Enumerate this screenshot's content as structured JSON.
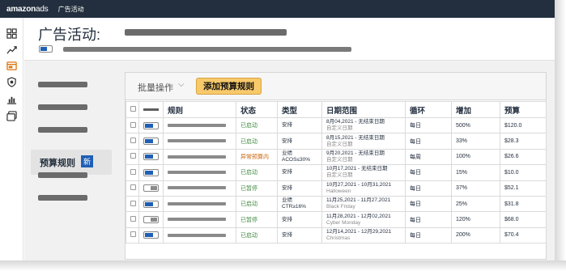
{
  "topbar": {
    "logo_main": "amazon",
    "logo_ads": "ads",
    "nav_title": "广告活动"
  },
  "colors": {
    "topbar": "#232f3e",
    "accent_blue": "#1f5fb4",
    "button_yellow": "#f7c96a",
    "status_green": "#3c8a3c",
    "status_orange": "#c8640a"
  },
  "rail": {
    "icons": [
      "dashboard-icon",
      "trend-icon",
      "campaign-icon",
      "shield-icon",
      "bar-chart-icon",
      "media-icon"
    ]
  },
  "header": {
    "title": "广告活动:"
  },
  "leftnav": {
    "active_label": "预算规则",
    "new_badge": "新"
  },
  "toolbar": {
    "bulk_label": "批量操作",
    "bulk_caret": "⌵",
    "add_button": "添加预算规则"
  },
  "table": {
    "headers": [
      "",
      "",
      "规则",
      "状态",
      "类型",
      "日期范围",
      "循环",
      "增加",
      "预算"
    ],
    "rows": [
      {
        "toggle": "on",
        "status": "已启动",
        "status_color": "green",
        "type1": "安排",
        "type2": "",
        "date1": "8月04,2021 - 无结束日期",
        "date2": "自定义日期",
        "cycle": "每日",
        "increase": "500%",
        "budget": "$120.0"
      },
      {
        "toggle": "on",
        "status": "已启动",
        "status_color": "green",
        "type1": "安排",
        "type2": "",
        "date1": "8月15,2021 - 无结束日期",
        "date2": "自定义日期",
        "cycle": "每日",
        "increase": "33%",
        "budget": "$28.3"
      },
      {
        "toggle": "on",
        "status": "异常预算内",
        "status_color": "orange",
        "type1": "业绩",
        "type2": "ACOS≤30%",
        "date1": "9月20,2021 - 无结束日期",
        "date2": "自定义日期",
        "cycle": "每周",
        "increase": "100%",
        "budget": "$26.6"
      },
      {
        "toggle": "on",
        "status": "已启动",
        "status_color": "green",
        "type1": "安排",
        "type2": "",
        "date1": "10月17,2021 - 无结束日期",
        "date2": "自定义日期",
        "cycle": "每日",
        "increase": "15%",
        "budget": "$10.0"
      },
      {
        "toggle": "off",
        "status": "已暂停",
        "status_color": "green",
        "type1": "安排",
        "type2": "",
        "date1": "10月27,2021 - 10月31,2021",
        "date2": "Halloween",
        "cycle": "每日",
        "increase": "37%",
        "budget": "$52.1"
      },
      {
        "toggle": "on",
        "status": "已启动",
        "status_color": "green",
        "type1": "业绩",
        "type2": "CTR≥16%",
        "date1": "11月25,2021 - 11月27,2021",
        "date2": "Black Friday",
        "cycle": "每日",
        "increase": "25%",
        "budget": "$31.8"
      },
      {
        "toggle": "off",
        "status": "已暂停",
        "status_color": "green",
        "type1": "安排",
        "type2": "",
        "date1": "11月28,2021 - 12月02,2021",
        "date2": "Cyber Monday",
        "cycle": "每日",
        "increase": "120%",
        "budget": "$68.0"
      },
      {
        "toggle": "on",
        "status": "已启动",
        "status_color": "green",
        "type1": "安排",
        "type2": "",
        "date1": "12月14,2021 - 12月29,2021",
        "date2": "Christmas",
        "cycle": "每日",
        "increase": "200%",
        "budget": "$70.4"
      }
    ]
  }
}
